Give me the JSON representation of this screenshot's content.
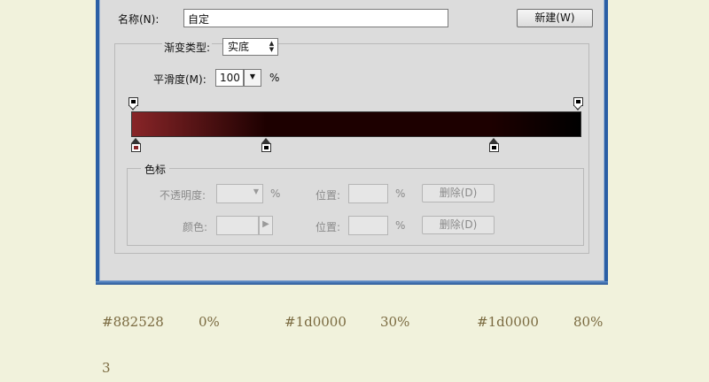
{
  "dialog": {
    "name_label": "名称(N):",
    "name_value": "自定",
    "new_button": "新建(W)",
    "gradient_type_label": "渐变类型:",
    "gradient_type_value": "实底",
    "smoothness_label": "平滑度(M):",
    "smoothness_value": "100",
    "smoothness_unit": "%",
    "gradient": {
      "stops": [
        {
          "color": "#882528",
          "location": 0
        },
        {
          "color": "#1d0000",
          "location": 30
        },
        {
          "color": "#1d0000",
          "location": 80
        },
        {
          "color": "#000000",
          "location": 100
        }
      ]
    },
    "color_stops": {
      "group_label": "色标",
      "opacity_label": "不透明度:",
      "opacity_unit": "%",
      "location_label": "位置:",
      "location_unit": "%",
      "delete_button": "删除(D)",
      "color_label": "颜色:",
      "location_label_2": "位置:",
      "location_unit_2": "%",
      "delete_button_2": "删除(D)"
    }
  },
  "legend": [
    {
      "color": "#882528",
      "pos": "0%"
    },
    {
      "color": "#1d0000",
      "pos": "30%"
    },
    {
      "color": "#1d0000",
      "pos": "80%"
    }
  ],
  "footer_number": "3"
}
